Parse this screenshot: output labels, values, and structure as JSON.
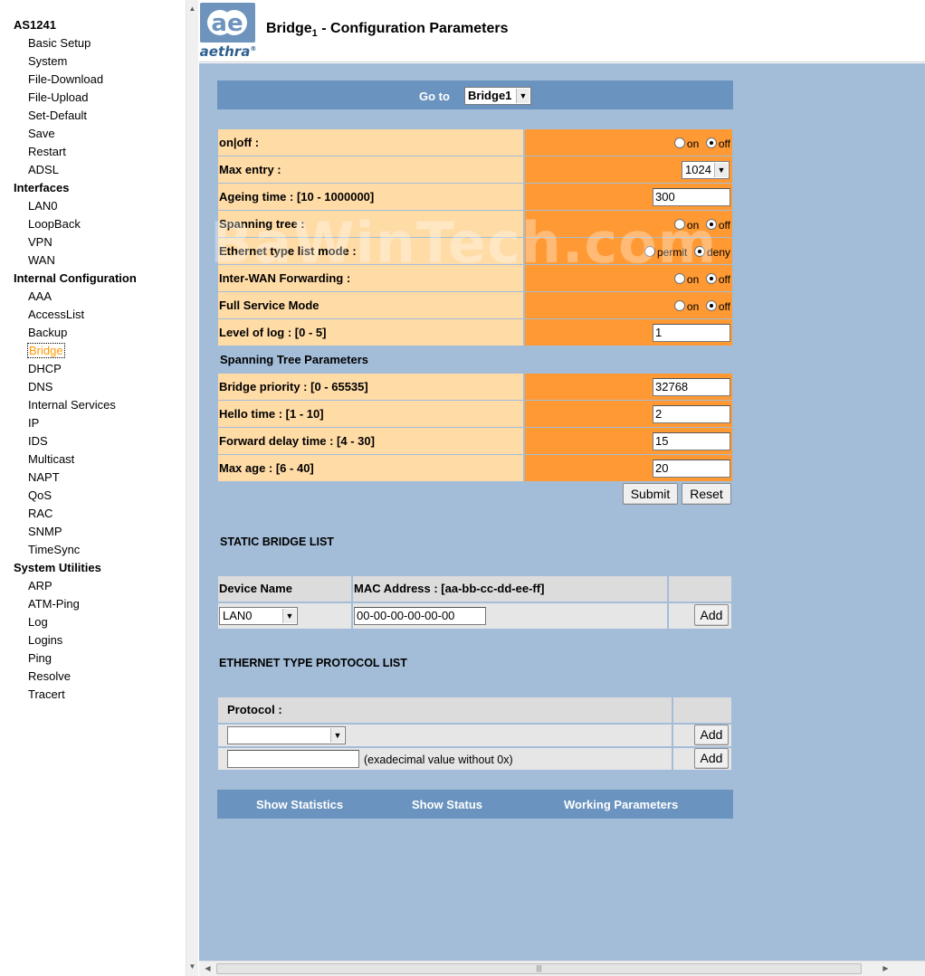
{
  "sidebar": {
    "groups": [
      {
        "label": "AS1241",
        "items": [
          "Basic Setup",
          "System",
          "File-Download",
          "File-Upload",
          "Set-Default",
          "Save",
          "Restart",
          "ADSL"
        ]
      },
      {
        "label": "Interfaces",
        "items": [
          "LAN0",
          "LoopBack",
          "VPN",
          "WAN"
        ]
      },
      {
        "label": "Internal Configuration",
        "items": [
          "AAA",
          "AccessList",
          "Backup",
          "Bridge",
          "DHCP",
          "DNS",
          "Internal Services",
          "IP",
          "IDS",
          "Multicast",
          "NAPT",
          "QoS",
          "RAC",
          "SNMP",
          "TimeSync"
        ]
      },
      {
        "label": "System Utilities",
        "items": [
          "ARP",
          "ATM-Ping",
          "Log",
          "Logins",
          "Ping",
          "Resolve",
          "Tracert"
        ]
      }
    ],
    "active": "Bridge"
  },
  "header": {
    "logo_text": "aethra",
    "logo_mark": "ae",
    "registered": "®",
    "title_pre": "Bridge",
    "title_sub": "1",
    "title_post": " - Configuration Parameters"
  },
  "goto": {
    "label": "Go to",
    "value": "Bridge1"
  },
  "params": {
    "onoff": {
      "label": "on|off :",
      "opt1": "on",
      "opt2": "off"
    },
    "max_entry": {
      "label": "Max entry :",
      "value": "1024"
    },
    "ageing": {
      "label": "Ageing time : [10 - 1000000]",
      "value": "300"
    },
    "spanning": {
      "label": "Spanning tree :",
      "opt1": "on",
      "opt2": "off"
    },
    "eth_mode": {
      "label": "Ethernet type list mode :",
      "opt1": "permit",
      "opt2": "deny"
    },
    "inter_wan": {
      "label": "Inter-WAN Forwarding :",
      "opt1": "on",
      "opt2": "off"
    },
    "full_service": {
      "label": "Full Service Mode",
      "opt1": "on",
      "opt2": "off"
    },
    "log_level": {
      "label": "Level of log : [0 - 5]",
      "value": "1"
    }
  },
  "stp": {
    "title": "Spanning Tree Parameters",
    "priority": {
      "label": "Bridge priority : [0 - 65535]",
      "value": "32768"
    },
    "hello": {
      "label": "Hello time : [1 - 10]",
      "value": "2"
    },
    "forward": {
      "label": "Forward delay time : [4 - 30]",
      "value": "15"
    },
    "max_age": {
      "label": "Max age : [6 - 40]",
      "value": "20"
    }
  },
  "buttons": {
    "submit": "Submit",
    "reset": "Reset",
    "add": "Add"
  },
  "static_list": {
    "title": "STATIC BRIDGE LIST",
    "col_device": "Device Name",
    "col_mac": "MAC Address : [aa-bb-cc-dd-ee-ff]",
    "device_value": "LAN0",
    "mac_value": "00-00-00-00-00-00"
  },
  "eth_list": {
    "title": "ETHERNET TYPE PROTOCOL LIST",
    "col_protocol": "Protocol :",
    "hex_hint": "(exadecimal value without 0x)"
  },
  "footer_links": {
    "stats": "Show Statistics",
    "status": "Show Status",
    "working": "Working Parameters"
  },
  "watermark": "BaWinTech.com",
  "colors": {
    "label_bg": "#ffdba6",
    "value_bg": "#ff9933",
    "bar_blue": "#6a93bf",
    "page_bg": "#a3bdd8",
    "active_link": "#ff9900"
  }
}
